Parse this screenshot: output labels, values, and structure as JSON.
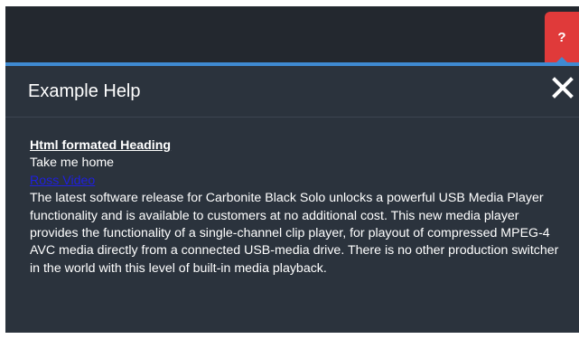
{
  "header": {
    "help_button_label": "?"
  },
  "panel": {
    "title": "Example Help",
    "close_icon": "close-icon"
  },
  "content": {
    "heading": "Html formated Heading",
    "line": "Take me home",
    "link_text": "Ross Video",
    "paragraph": "The latest software release for Carbonite Black Solo unlocks a powerful USB Media Player functionality and is available to customers at no additional cost. This new media player provides the functionality of a single-channel clip player, for playout of compressed MPEG-4 AVC media directly from a connected USB-media drive. There is no other production switcher in the world with this level of built-in media playback."
  },
  "colors": {
    "top_bar": "#23282f",
    "panel_bg": "#2b333d",
    "accent": "#3f8ad1",
    "help_button": "#e03a3a",
    "link": "#1f1fe0"
  }
}
